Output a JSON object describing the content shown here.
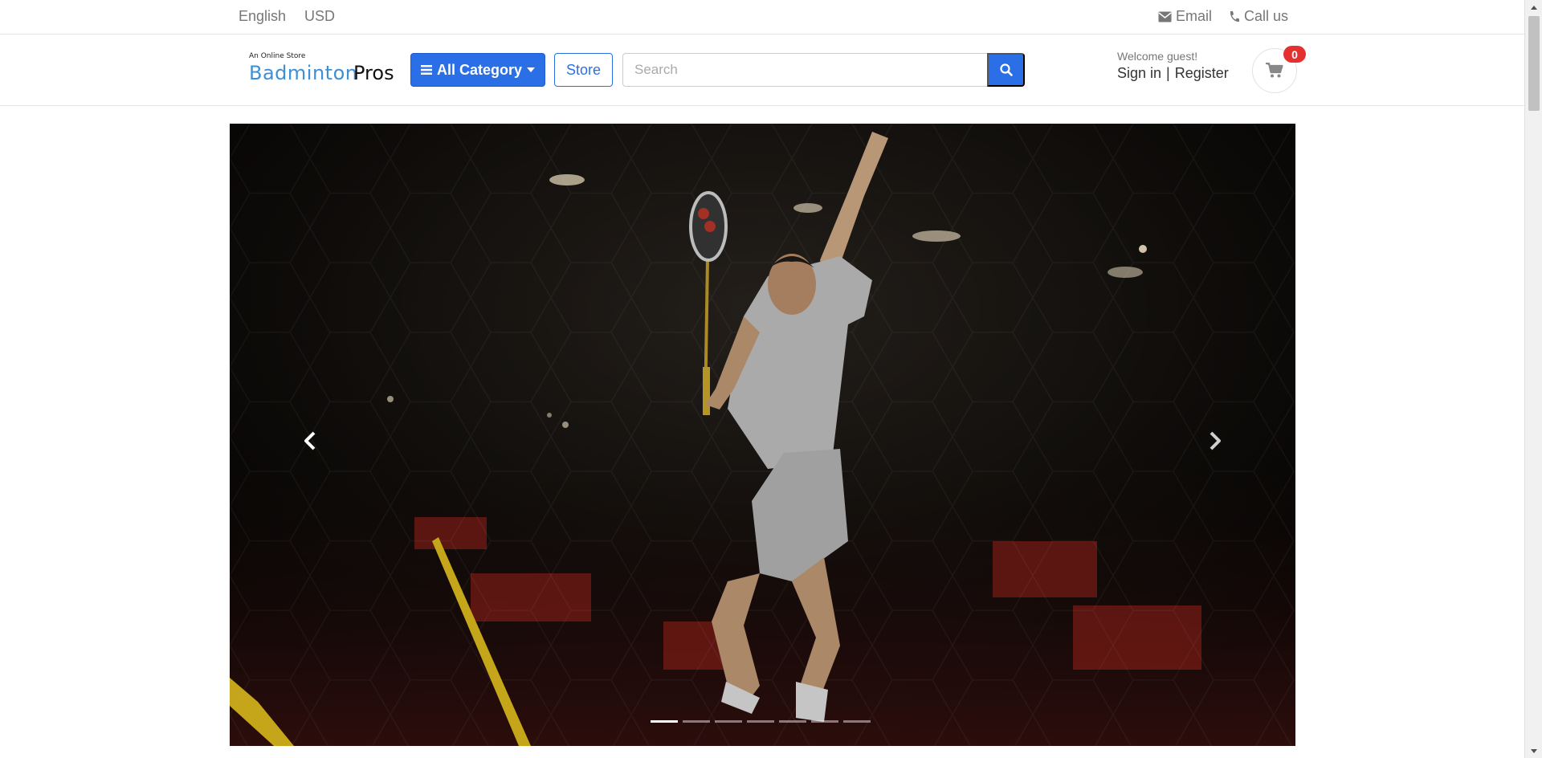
{
  "topbar": {
    "language": "English",
    "currency": "USD",
    "email_label": "Email",
    "call_label": "Call us",
    "email_icon": "envelope-icon",
    "call_icon": "phone-icon"
  },
  "header": {
    "logo": {
      "tagline": "An Online Store",
      "name_part1": "Badminton",
      "name_part2": "Pros"
    },
    "category_button": "All Category",
    "store_button": "Store",
    "search_placeholder": "Search",
    "welcome_text": "Welcome guest!",
    "sign_in": "Sign in",
    "separator": "|",
    "register": "Register",
    "cart_count": "0",
    "cart_icon": "shopping-cart-icon"
  },
  "carousel": {
    "slide_count": 7,
    "active_index": 0,
    "prev_icon": "chevron-left-icon",
    "next_icon": "chevron-right-icon"
  },
  "colors": {
    "primary": "#2b6fe6",
    "logo_blue": "#3d8fd6",
    "badge_red": "#e53030",
    "muted_text": "#777777"
  }
}
